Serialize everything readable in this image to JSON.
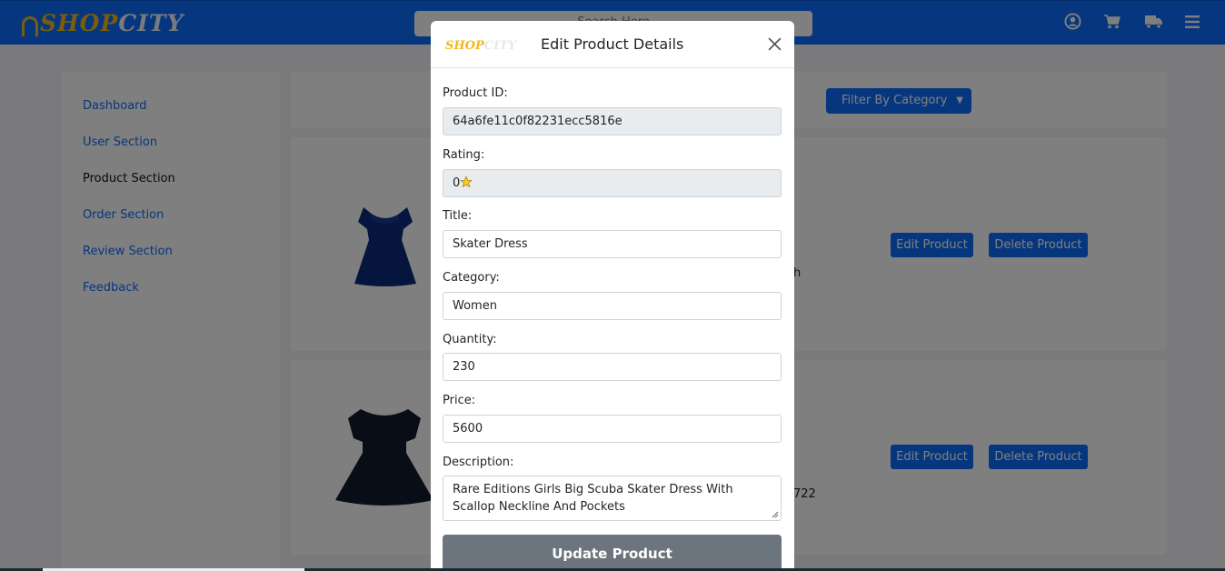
{
  "header": {
    "logo_text_1": "SHOP",
    "logo_text_2": "CITY",
    "search_placeholder": "Search Here",
    "icons": [
      "user-circle-icon",
      "cart-icon",
      "truck-icon",
      "menu-icon"
    ]
  },
  "sidebar": {
    "items": [
      {
        "label": "Dashboard",
        "active": false
      },
      {
        "label": "User Section",
        "active": false
      },
      {
        "label": "Product Section",
        "active": true
      },
      {
        "label": "Order Section",
        "active": false
      },
      {
        "label": "Review Section",
        "active": false
      },
      {
        "label": "Feedback",
        "active": false
      }
    ]
  },
  "filter": {
    "label": "Filter By Category"
  },
  "products": [
    {
      "edit_label": "Edit Product",
      "delete_label": "Delete Product",
      "fragment": "h"
    },
    {
      "edit_label": "Edit Product",
      "delete_label": "Delete Product",
      "fragment": "722"
    }
  ],
  "modal": {
    "logo_text": "SHOP",
    "title": "Edit Product Details",
    "fields": {
      "product_id": {
        "label": "Product ID:",
        "value": "64a6fe11c0f82231ecc5816e"
      },
      "rating": {
        "label": "Rating:",
        "value": "0"
      },
      "title": {
        "label": "Title:",
        "value": "Skater Dress"
      },
      "category": {
        "label": "Category:",
        "value": "Women"
      },
      "quantity": {
        "label": "Quantity:",
        "value": "230"
      },
      "price": {
        "label": "Price:",
        "value": "5600"
      },
      "description": {
        "label": "Description:",
        "value": "Rare Editions Girls Big Scuba Skater Dress With Scallop Neckline And Pockets"
      }
    },
    "submit_label": "Update Product"
  },
  "colors": {
    "primary": "#0d6efd",
    "logo_gold": "#f5b81b",
    "update_button": "#6c757d",
    "dress_navy": "#0a2a7a",
    "dress_black": "#121a2e"
  }
}
